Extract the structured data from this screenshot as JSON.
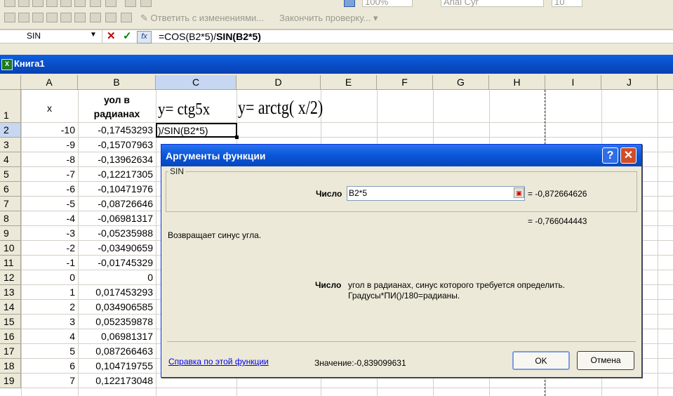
{
  "toolbar": {
    "reply_label": "Ответить с изменениями...",
    "finish_label": "Закончить проверку...",
    "zoom": "100%",
    "font": "Arial Cyr",
    "size": "10"
  },
  "formula_bar": {
    "name_box": "SIN",
    "formula_prefix": "=COS(B2*5)/",
    "formula_suffix": "SIN(B2*5)"
  },
  "workbook": {
    "title": "Книга1"
  },
  "grid": {
    "columns": [
      "A",
      "B",
      "C",
      "D",
      "E",
      "F",
      "G",
      "H",
      "I",
      "J"
    ],
    "header_row": {
      "a": "x",
      "b_line1": "уол в",
      "b_line2": "радианах",
      "c": "y= ctg5x",
      "d": "y= arctg( x/2)"
    },
    "editing_cell": ")/SIN(B2*5)",
    "rows": [
      {
        "n": "1"
      },
      {
        "n": "2",
        "a": "-10",
        "b": "-0,17453293"
      },
      {
        "n": "3",
        "a": "-9",
        "b": "-0,15707963"
      },
      {
        "n": "4",
        "a": "-8",
        "b": "-0,13962634"
      },
      {
        "n": "5",
        "a": "-7",
        "b": "-0,12217305"
      },
      {
        "n": "6",
        "a": "-6",
        "b": "-0,10471976"
      },
      {
        "n": "7",
        "a": "-5",
        "b": "-0,08726646"
      },
      {
        "n": "8",
        "a": "-4",
        "b": "-0,06981317"
      },
      {
        "n": "9",
        "a": "-3",
        "b": "-0,05235988"
      },
      {
        "n": "10",
        "a": "-2",
        "b": "-0,03490659"
      },
      {
        "n": "11",
        "a": "-1",
        "b": "-0,01745329"
      },
      {
        "n": "12",
        "a": "0",
        "b": "0"
      },
      {
        "n": "13",
        "a": "1",
        "b": "0,017453293"
      },
      {
        "n": "14",
        "a": "2",
        "b": "0,034906585"
      },
      {
        "n": "15",
        "a": "3",
        "b": "0,052359878"
      },
      {
        "n": "16",
        "a": "4",
        "b": "0,06981317"
      },
      {
        "n": "17",
        "a": "5",
        "b": "0,087266463"
      },
      {
        "n": "18",
        "a": "6",
        "b": "0,104719755"
      },
      {
        "n": "19",
        "a": "7",
        "b": "0,122173048"
      }
    ]
  },
  "dialog": {
    "title": "Аргументы функции",
    "function_name": "SIN",
    "arg_label": "Число",
    "arg_value": "B2*5",
    "arg_result": "= -0,872664626",
    "func_result": "= -0,766044443",
    "description": "Возвращает синус угла.",
    "arg_help_label": "Число",
    "arg_help_line1": "угол в радианах, синус которого требуется определить.",
    "arg_help_line2": "Градусы*ПИ()/180=радианы.",
    "help_link": "Справка по этой функции",
    "value_label": "Значение:",
    "value": "-0,839099631",
    "ok": "OK",
    "cancel": "Отмена",
    "help_glyph": "?",
    "close_glyph": "✕"
  }
}
